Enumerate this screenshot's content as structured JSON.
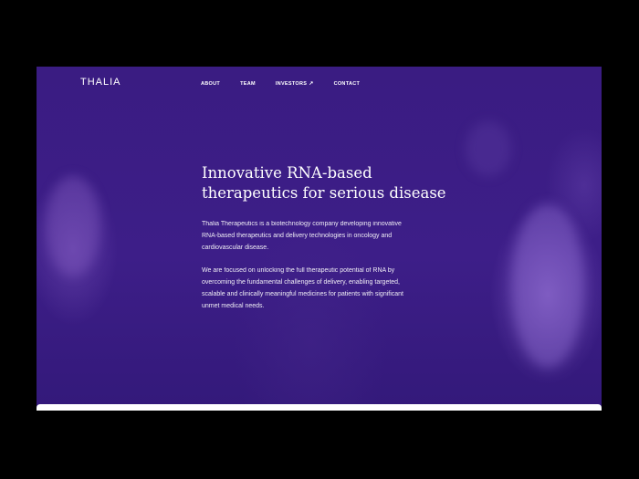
{
  "brand": {
    "logo_text": "THALIA"
  },
  "nav": {
    "items": [
      {
        "label": "ABOUT"
      },
      {
        "label": "TEAM"
      },
      {
        "label": "INVESTORS",
        "icon": "external-link-icon"
      },
      {
        "label": "CONTACT"
      }
    ]
  },
  "hero": {
    "headline_line1": "Innovative RNA-based",
    "headline_line2": "therapeutics for serious disease",
    "paragraph1": "Thalia Therapeutics is a biotechnology company developing innovative RNA-based therapeutics and delivery technologies in oncology and cardiovascular disease.",
    "paragraph2": "We are focused on unlocking the full therapeutic potential of RNA by overcoming the fundamental challenges of delivery, enabling targeted, scalable and clinically meaningful medicines for patients with significant unmet medical needs."
  },
  "colors": {
    "background": "#3b1d83",
    "text": "#ffffff",
    "outer": "#000000"
  }
}
